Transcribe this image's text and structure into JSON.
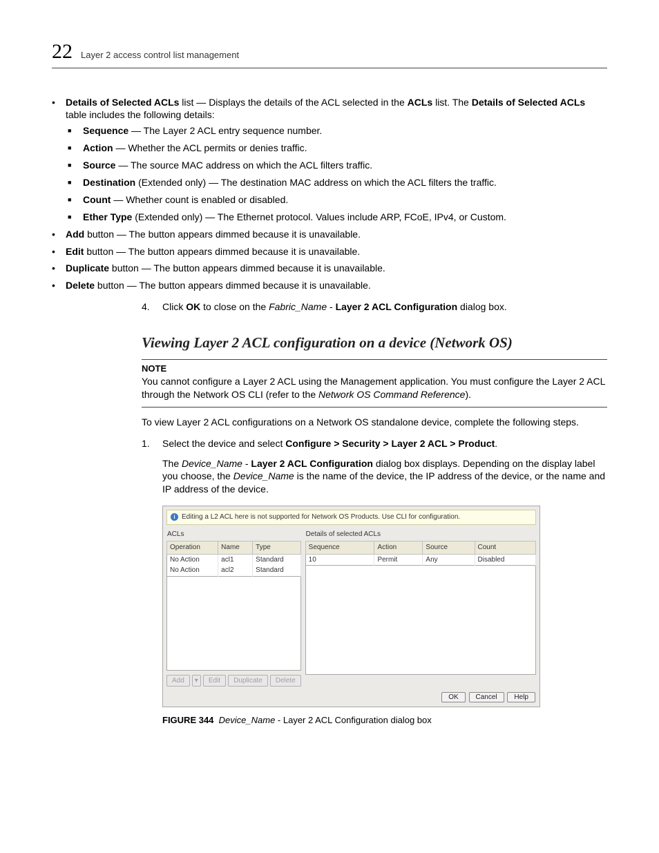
{
  "header": {
    "page_number": "22",
    "title": "Layer 2 access control list management"
  },
  "content": {
    "details_intro_b1": "Details of Selected ACLs",
    "details_intro_t1": " list — Displays the details of the ACL selected in the ",
    "details_intro_b2": "ACLs",
    "details_intro_t2": " list. The ",
    "details_intro_b3": "Details of Selected ACLs",
    "details_intro_t3": " table includes the following details:",
    "sub": {
      "seq_b": "Sequence",
      "seq_t": " — The Layer 2 ACL entry sequence number.",
      "act_b": "Action",
      "act_t": " — Whether the ACL permits or denies traffic.",
      "src_b": "Source",
      "src_t": " — The source MAC address on which the ACL filters traffic.",
      "dst_b": "Destination",
      "dst_t": " (Extended only) — The destination MAC address on which the ACL filters the traffic.",
      "cnt_b": "Count",
      "cnt_t": " — Whether count is enabled or disabled.",
      "eth_b": "Ether Type",
      "eth_t": " (Extended only) — The Ethernet protocol. Values include ARP, FCoE, IPv4, or Custom."
    },
    "add_b": "Add",
    "add_t": " button — The button appears dimmed because it is unavailable.",
    "edit_b": "Edit",
    "edit_t": " button — The button appears dimmed because it is unavailable.",
    "dup_b": "Duplicate",
    "dup_t": " button — The button appears dimmed because it is unavailable.",
    "del_b": "Delete",
    "del_t": " button — The button appears dimmed because it is unavailable.",
    "step4_num": "4.",
    "step4_t1": "Click ",
    "step4_b1": "OK",
    "step4_t2": " to close on the ",
    "step4_i1": "Fabric_Name",
    "step4_t3": " - ",
    "step4_b2": "Layer 2 ACL Configuration",
    "step4_t4": " dialog box.",
    "heading": "Viewing Layer 2 ACL configuration on a device (Network OS)",
    "note_title": "NOTE",
    "note_t1": "You cannot configure a Layer 2 ACL using the Management application. You must configure the Layer 2 ACL through the Network OS CLI (refer to the ",
    "note_i1": "Network OS Command Reference",
    "note_t2": ").",
    "para1": "To view Layer 2 ACL configurations on a Network OS standalone device, complete the following steps.",
    "step1_num": "1.",
    "step1_t1": "Select the device and select ",
    "step1_b1": "Configure > Security > Layer 2 ACL > Product",
    "step1_t2": ".",
    "step1_body_t1": "The ",
    "step1_body_i1": "Device_Name",
    "step1_body_t2": " - ",
    "step1_body_b1": "Layer 2 ACL Configuration",
    "step1_body_t3": " dialog box displays. Depending on the display label you choose, the ",
    "step1_body_i2": "Device_Name",
    "step1_body_t4": " is the name of the device, the IP address of the device, or the name and IP address of the device."
  },
  "dialog": {
    "warning": "Editing a L2 ACL here is not supported for Network OS Products. Use CLI for configuration.",
    "left_title": "ACLs",
    "right_title": "Details of selected ACLs",
    "left_headers": {
      "c1": "Operation",
      "c2": "Name",
      "c3": "Type"
    },
    "left_rows": [
      {
        "c1": "No Action",
        "c2": "acl1",
        "c3": "Standard"
      },
      {
        "c1": "No Action",
        "c2": "acl2",
        "c3": "Standard"
      }
    ],
    "right_headers": {
      "c1": "Sequence",
      "c2": "Action",
      "c3": "Source",
      "c4": "Count"
    },
    "right_rows": [
      {
        "c1": "10",
        "c2": "Permit",
        "c3": "Any",
        "c4": "Disabled"
      }
    ],
    "buttons": {
      "add": "Add",
      "edit": "Edit",
      "dup": "Duplicate",
      "del": "Delete"
    },
    "footer": {
      "ok": "OK",
      "cancel": "Cancel",
      "help": "Help"
    }
  },
  "figure": {
    "num": "FIGURE 344",
    "dev": "Device_Name",
    "rest": " - Layer 2 ACL Configuration dialog box"
  }
}
